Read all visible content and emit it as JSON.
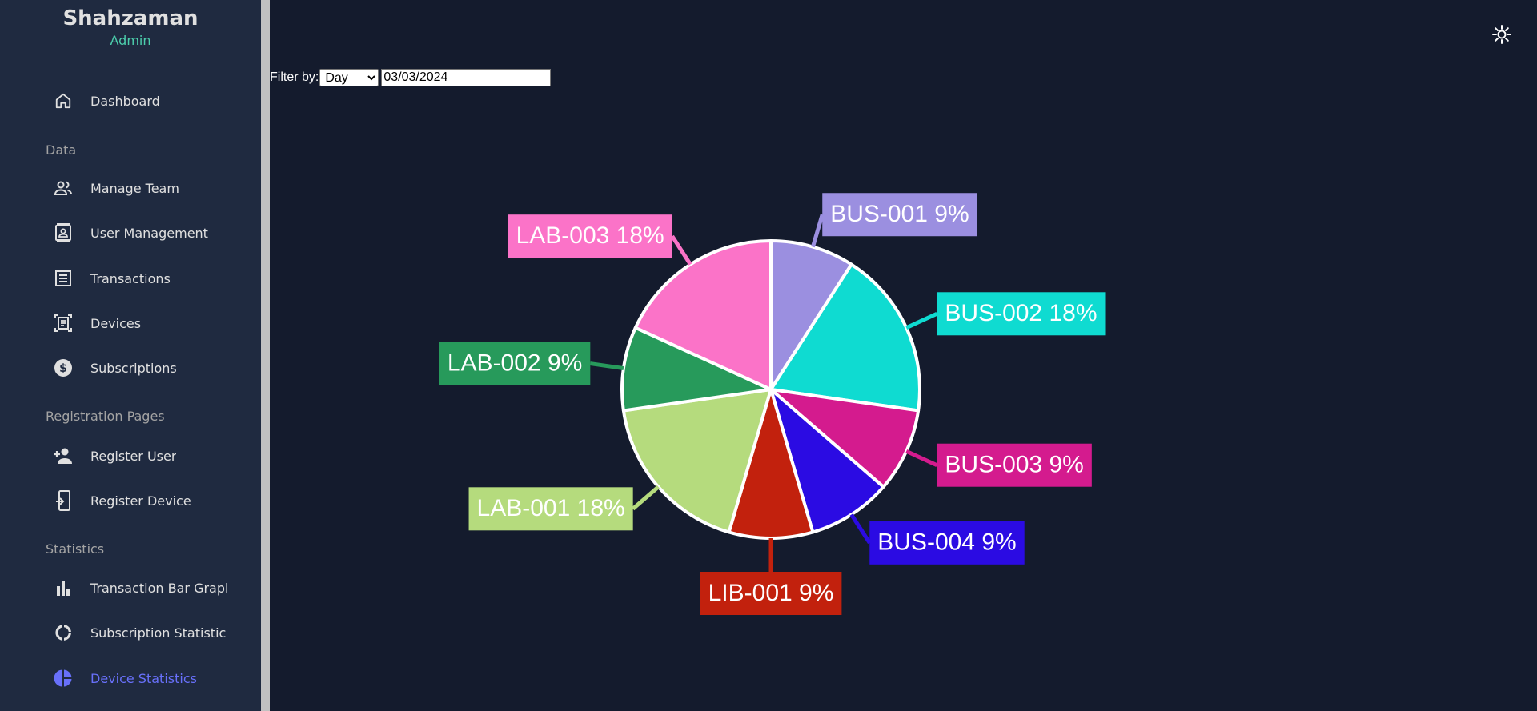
{
  "sidebar": {
    "user_name": "Shahzaman",
    "user_role": "Admin",
    "items": [
      {
        "label": "Dashboard",
        "icon": "home-icon"
      },
      {
        "label": "Manage Team",
        "icon": "people-icon"
      },
      {
        "label": "User Management",
        "icon": "contact-card-icon"
      },
      {
        "label": "Transactions",
        "icon": "receipt-icon"
      },
      {
        "label": "Devices",
        "icon": "document-scanner-icon"
      },
      {
        "label": "Subscriptions",
        "icon": "dollar-circle-icon"
      },
      {
        "label": "Register User",
        "icon": "person-add-icon"
      },
      {
        "label": "Register Device",
        "icon": "device-add-icon"
      },
      {
        "label": "Transaction Bar Graph",
        "icon": "bar-chart-icon"
      },
      {
        "label": "Subscription Statistics",
        "icon": "donut-chart-icon"
      },
      {
        "label": "Device Statistics",
        "icon": "pie-chart-icon"
      }
    ],
    "sections": {
      "data": "Data",
      "registration": "Registration Pages",
      "statistics": "Statistics"
    },
    "active_item": "Device Statistics"
  },
  "filter": {
    "label": "Filter by:",
    "selected": "Day",
    "options": [
      "Day"
    ],
    "date_value": "03/03/2024"
  },
  "colors": {
    "background": "#141b2d",
    "sidebar": "#1f2a40",
    "accent": "#6870fa",
    "role": "#4cceac"
  },
  "chart_data": {
    "type": "pie",
    "title": "",
    "slices": [
      {
        "label": "BUS-001",
        "value": 9,
        "color": "#9b8fe0"
      },
      {
        "label": "BUS-002",
        "value": 18,
        "color": "#0fdbd1"
      },
      {
        "label": "BUS-003",
        "value": 9,
        "color": "#d41b8e"
      },
      {
        "label": "BUS-004",
        "value": 9,
        "color": "#2b0be3"
      },
      {
        "label": "LIB-001",
        "value": 9,
        "color": "#c2210d"
      },
      {
        "label": "LAB-001",
        "value": 18,
        "color": "#b5db7d"
      },
      {
        "label": "LAB-002",
        "value": 9,
        "color": "#279a5b"
      },
      {
        "label": "LAB-003",
        "value": 18,
        "color": "#fb73c8"
      }
    ],
    "label_format": "{label} {value}%"
  }
}
